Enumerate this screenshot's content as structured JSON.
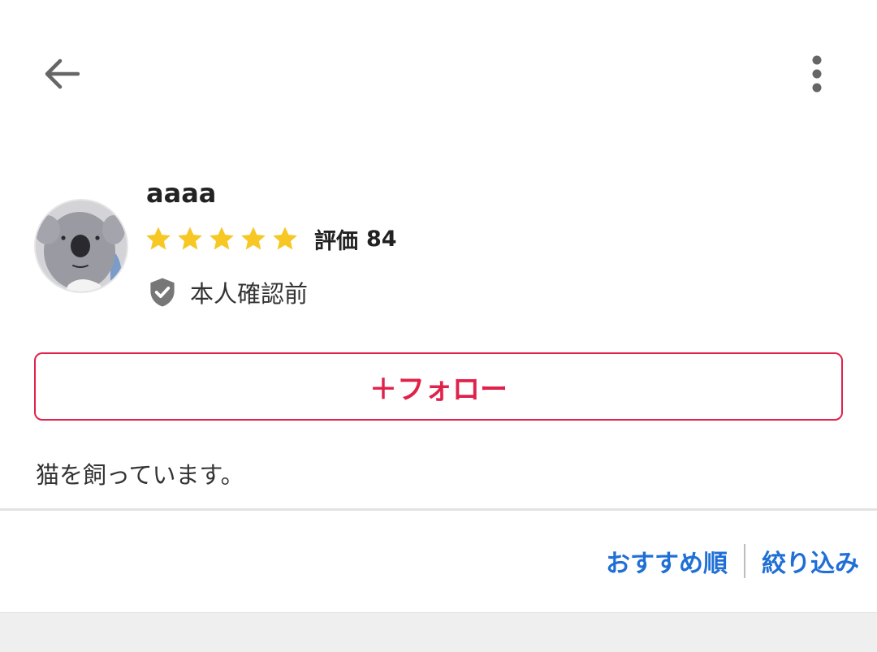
{
  "header": {
    "back_icon": "arrow-left-icon",
    "menu_icon": "more-vertical-icon"
  },
  "profile": {
    "username": "aaaa",
    "avatar_icon": "koala-avatar",
    "rating": {
      "stars": 5,
      "label": "評価",
      "count": "84",
      "star_color": "#f7c724"
    },
    "verification": {
      "icon": "shield-check-icon",
      "text": "本人確認前"
    },
    "follow_label": "＋フォロー",
    "bio": "猫を飼っています。"
  },
  "sort_bar": {
    "sort_label": "おすすめ順",
    "filter_label": "絞り込み",
    "link_color": "#1f6fd6"
  },
  "colors": {
    "accent": "#e0224a"
  }
}
